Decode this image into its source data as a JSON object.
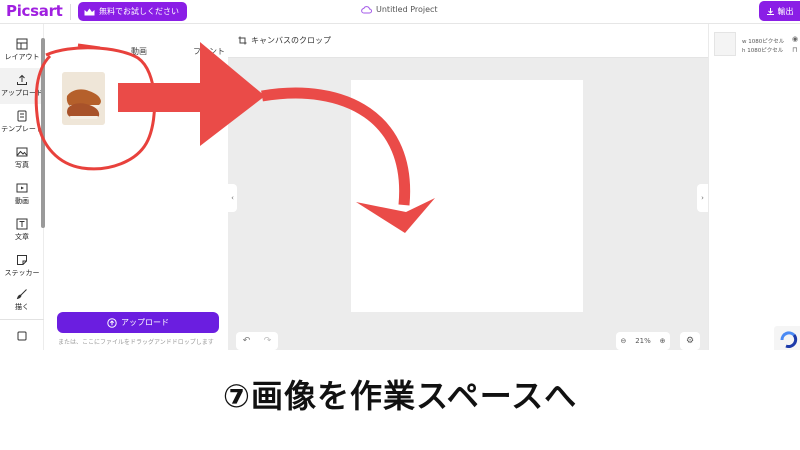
{
  "header": {
    "logo": "Picsart",
    "try_free_label": "無料でお試しください",
    "project_title": "Untitled Project",
    "export_label": "輸出"
  },
  "rail": {
    "items": [
      {
        "label": "レイアウト",
        "icon": "layout-icon"
      },
      {
        "label": "アップロード",
        "icon": "upload-icon"
      },
      {
        "label": "テンプレート",
        "icon": "template-icon"
      },
      {
        "label": "写真",
        "icon": "photo-icon"
      },
      {
        "label": "動画",
        "icon": "video-icon"
      },
      {
        "label": "文章",
        "icon": "text-icon"
      },
      {
        "label": "ステッカー",
        "icon": "sticker-icon"
      },
      {
        "label": "描く",
        "icon": "brush-icon"
      }
    ]
  },
  "panel": {
    "tabs": [
      "動画",
      "フォント"
    ],
    "upload_button": "アップロード",
    "hint": "または、ここにファイルをドラッグアンドドロップします"
  },
  "workspace": {
    "crop_label": "キャンバスのクロップ",
    "zoom": "21%"
  },
  "right_panel": {
    "width_label": "w 1080ピクセル",
    "height_label": "h 1080ピクセル"
  },
  "caption": {
    "text": "⑦画像を作業スペースへ"
  },
  "colors": {
    "brand": "#8a1ee6",
    "upload_button": "#6b1ee0",
    "annotation_red": "#e8413c",
    "workspace_bg": "#ececec"
  }
}
